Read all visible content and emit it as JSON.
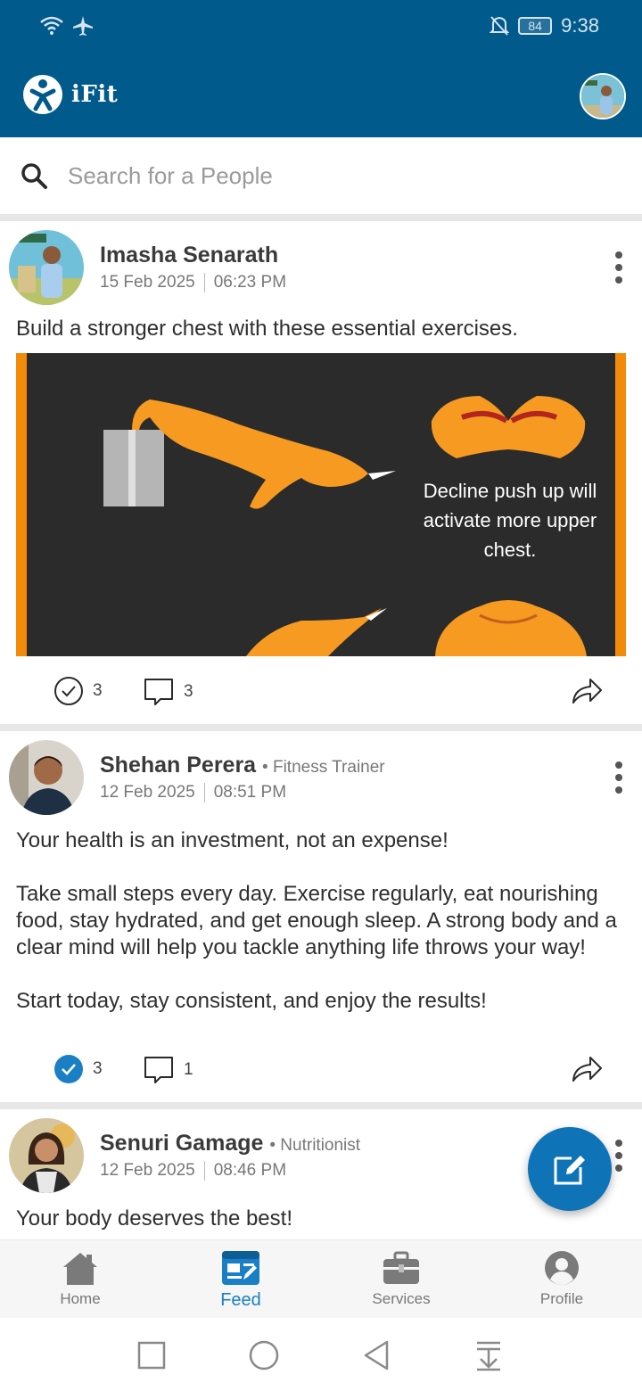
{
  "status": {
    "battery": "84",
    "time": "9:38"
  },
  "app": {
    "title": "iFit"
  },
  "search": {
    "placeholder": "Search for a People"
  },
  "posts": [
    {
      "author": "Imasha Senarath",
      "role": "",
      "date": "15 Feb 2025",
      "time": "06:23 PM",
      "text": "Build a stronger chest with these essential exercises.",
      "image_caption": "Decline push up will activate more upper chest.",
      "likes": "3",
      "comments": "3",
      "liked": false
    },
    {
      "author": "Shehan Perera",
      "role": "Fitness Trainer",
      "date": "12 Feb 2025",
      "time": "08:51 PM",
      "text": "Your health is an investment, not an expense!\n\nTake small steps every day. Exercise regularly, eat nourishing food, stay hydrated, and get enough sleep. A strong body and a clear mind will help you tackle anything life throws your way!\n\nStart today, stay consistent, and enjoy the results!",
      "likes": "3",
      "comments": "1",
      "liked": true
    },
    {
      "author": "Senuri Gamage",
      "role": "Nutritionist",
      "date": "12 Feb 2025",
      "time": "08:46 PM",
      "text": "Your body deserves the best!"
    }
  ],
  "nav": [
    {
      "label": "Home",
      "icon": "home-icon"
    },
    {
      "label": "Feed",
      "icon": "feed-icon"
    },
    {
      "label": "Services",
      "icon": "briefcase-icon"
    },
    {
      "label": "Profile",
      "icon": "profile-icon"
    }
  ],
  "colors": {
    "primary": "#005a8c",
    "accent": "#0f73b8",
    "active_nav": "#1a7fc4"
  }
}
